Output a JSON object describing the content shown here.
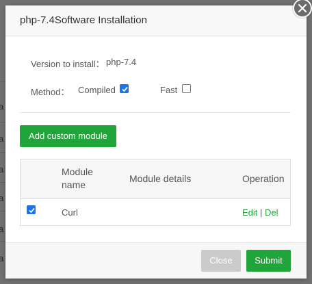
{
  "background": {
    "row_fragments": [
      "ar",
      "ar",
      "ar",
      "ar",
      "ar",
      "ar"
    ]
  },
  "dialog": {
    "title": "php-7.4Software Installation",
    "version_label": "Version to install：",
    "version_value": "php-7.4",
    "method_label": "Method：",
    "methods": [
      {
        "label": "Compiled",
        "checked": true
      },
      {
        "label": "Fast",
        "checked": false
      }
    ],
    "add_module_label": "Add custom module",
    "table": {
      "headers": [
        "Module name",
        "Module details",
        "Operation"
      ],
      "rows": [
        {
          "checked": true,
          "module_name": "Curl",
          "details": "",
          "edit_label": "Edit",
          "separator": "|",
          "del_label": "Del"
        }
      ]
    },
    "footer": {
      "close_label": "Close",
      "submit_label": "Submit"
    }
  },
  "colors": {
    "accent_green": "#20a53a",
    "checkbox_blue": "#1a73e8",
    "disabled_grey": "#cbcbcb"
  }
}
